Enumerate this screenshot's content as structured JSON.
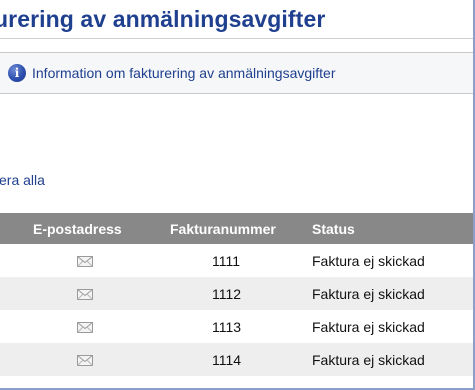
{
  "page": {
    "title": "urering av anmälningsavgifter"
  },
  "info": {
    "icon": "info-icon",
    "link_text": "Information om fakturering av anmälningsavgifter"
  },
  "actions": {
    "select_all": "era alla"
  },
  "table": {
    "headers": {
      "email": "E-postadress",
      "invoice_number": "Fakturanummer",
      "status": "Status"
    },
    "rows": [
      {
        "email_icon": "envelope-icon",
        "invoice_number": "1111",
        "status": "Faktura ej skickad"
      },
      {
        "email_icon": "envelope-icon",
        "invoice_number": "1112",
        "status": "Faktura ej skickad"
      },
      {
        "email_icon": "envelope-icon",
        "invoice_number": "1113",
        "status": "Faktura ej skickad"
      },
      {
        "email_icon": "envelope-icon",
        "invoice_number": "1114",
        "status": "Faktura ej skickad"
      }
    ]
  },
  "colors": {
    "title": "#1f3f8f",
    "link": "#1f3f8f",
    "header_bg": "#888888",
    "row_alt_bg": "#eeeeee"
  }
}
